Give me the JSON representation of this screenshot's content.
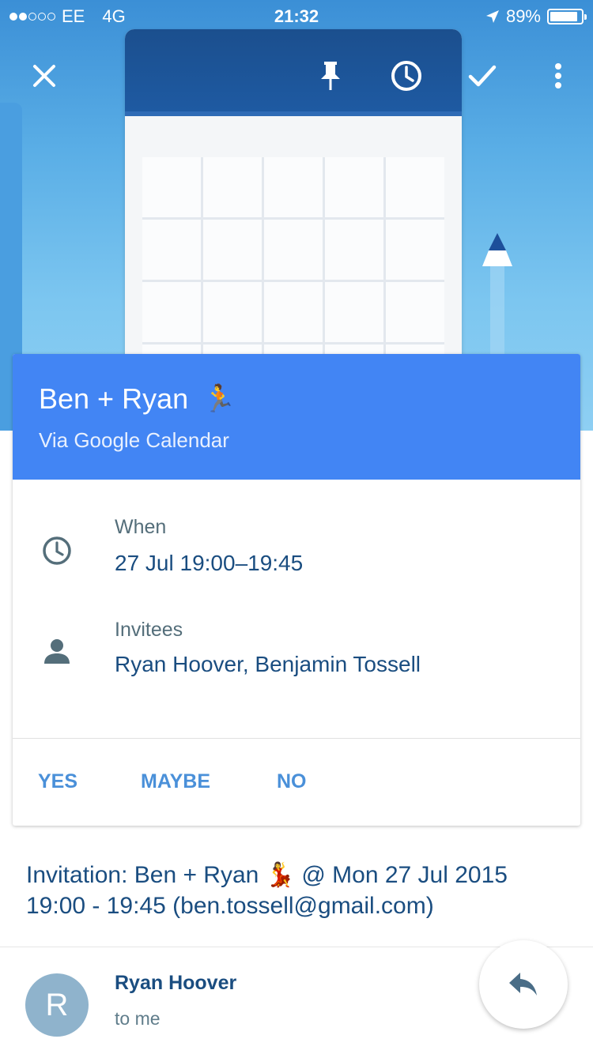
{
  "status_bar": {
    "carrier": "EE",
    "network": "4G",
    "time": "21:32",
    "battery_percent": "89%",
    "battery_level": 0.89,
    "signal_bars_filled": 2,
    "signal_bars_total": 5
  },
  "toolbar": {
    "close_icon": "close-icon",
    "pin_icon": "pin-icon",
    "snooze_icon": "clock-icon",
    "done_icon": "check-icon",
    "more_icon": "more-vert-icon"
  },
  "event": {
    "title": "Ben + Ryan",
    "title_emoji": "🏃",
    "source": "Via Google Calendar",
    "when_label": "When",
    "when_value": "27 Jul 19:00–19:45",
    "invitees_label": "Invitees",
    "invitees_value": "Ryan Hoover, Benjamin Tossell",
    "rsvp": {
      "yes": "YES",
      "maybe": "MAYBE",
      "no": "NO"
    }
  },
  "email": {
    "subject": "Invitation: Ben + Ryan 💃 @ Mon 27 Jul 2015 19:00 - 19:45 (ben.tossell@gmail.com)",
    "sender_initial": "R",
    "sender_name": "Ryan Hoover",
    "recipient": "to me"
  },
  "colors": {
    "header_blue": "#4285f4",
    "text_navy": "#1a4d80",
    "rsvp_blue": "#4a90d9",
    "label_grey": "#546e7a"
  }
}
